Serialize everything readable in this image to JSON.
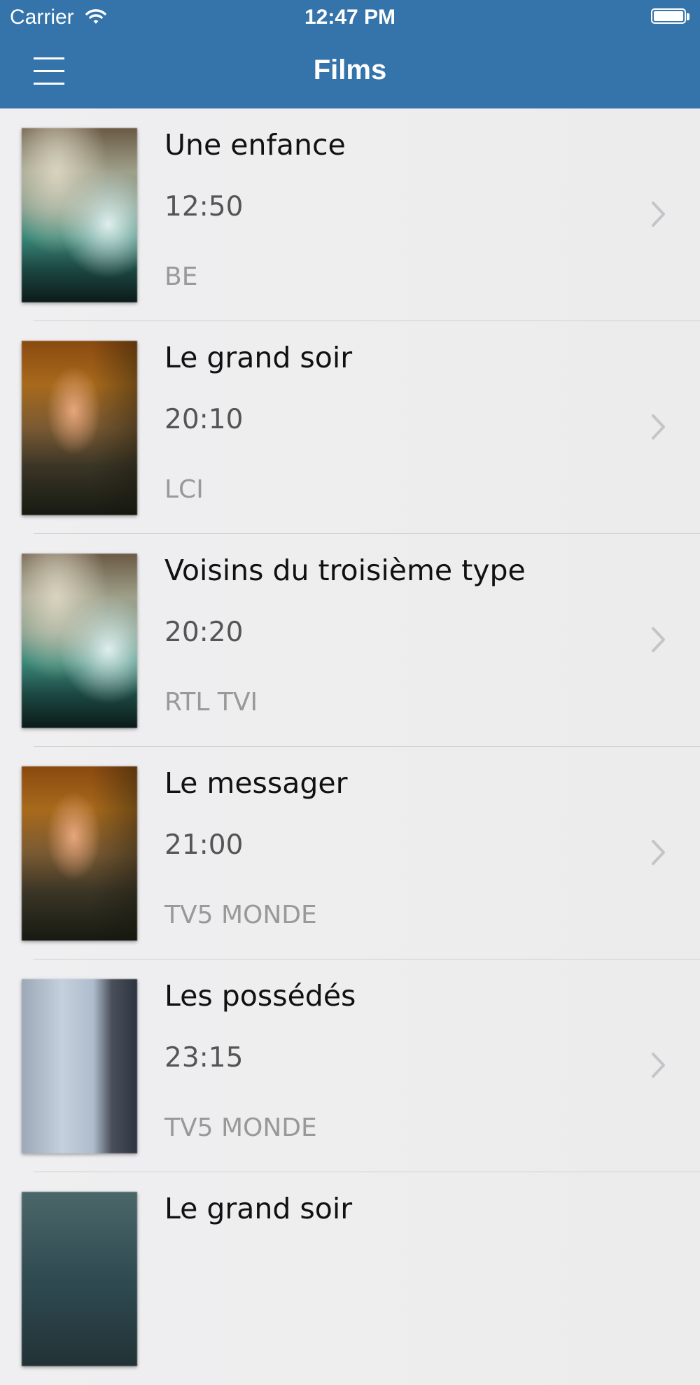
{
  "status_bar": {
    "carrier": "Carrier",
    "time": "12:47 PM",
    "wifi_icon": "wifi-icon",
    "battery_icon": "battery-icon"
  },
  "nav": {
    "title": "Films",
    "menu_icon": "hamburger-menu-icon"
  },
  "colors": {
    "header_background": "#3474aa",
    "list_background": "#ececec",
    "title_text": "#111111",
    "time_text": "#555555",
    "channel_text": "#999999"
  },
  "films": [
    {
      "title": "Une enfance",
      "time": "12:50",
      "channel": "BE",
      "poster": "green"
    },
    {
      "title": "Le grand soir",
      "time": "20:10",
      "channel": "LCI",
      "poster": "orange"
    },
    {
      "title": "Voisins du troisième type",
      "time": "20:20",
      "channel": "RTL TVI",
      "poster": "green"
    },
    {
      "title": "Le messager",
      "time": "21:00",
      "channel": "TV5 MONDE",
      "poster": "orange"
    },
    {
      "title": "Les possédés",
      "time": "23:15",
      "channel": "TV5 MONDE",
      "poster": "blue"
    },
    {
      "title": "Le grand soir",
      "time": "",
      "channel": "",
      "poster": "teal"
    }
  ]
}
